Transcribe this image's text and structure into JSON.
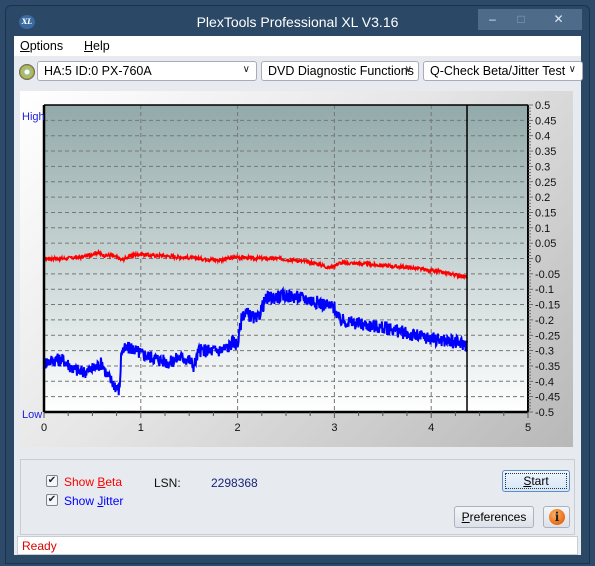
{
  "window": {
    "title": "PlexTools Professional XL V3.16",
    "app_icon_label": "XL",
    "controls": {
      "minimize": "–",
      "maximize": "□",
      "close": "✕"
    }
  },
  "menu": {
    "items": [
      {
        "label": "Options",
        "mnemonic": "O",
        "rest": "ptions"
      },
      {
        "label": "Help",
        "mnemonic": "H",
        "rest": "elp"
      }
    ]
  },
  "toolbar": {
    "drive_select": {
      "value": "HA:5 ID:0  PX-760A"
    },
    "function_select": {
      "value": "DVD Diagnostic Functions"
    },
    "test_select": {
      "value": "Q-Check Beta/Jitter Test"
    }
  },
  "chart": {
    "high_label": "High",
    "low_label": "Low"
  },
  "chart_data": {
    "type": "line",
    "title": "",
    "xlabel": "",
    "ylabel": "",
    "xlim": [
      0,
      5
    ],
    "ylim": [
      -0.5,
      0.5
    ],
    "x_ticks": [
      "0",
      "1",
      "2",
      "3",
      "4",
      "5"
    ],
    "y_ticks": [
      "0.5",
      "0.45",
      "0.4",
      "0.35",
      "0.3",
      "0.25",
      "0.2",
      "0.15",
      "0.1",
      "0.05",
      "0",
      "-0.05",
      "-0.1",
      "-0.15",
      "-0.2",
      "-0.25",
      "-0.3",
      "-0.35",
      "-0.4",
      "-0.45",
      "-0.5"
    ],
    "left_axis_labels": {
      "top": "High",
      "bottom": "Low"
    },
    "grid": true,
    "marker_line_x": 4.37,
    "series": [
      {
        "name": "Beta",
        "color": "#ff0000",
        "x": [
          0,
          0.2,
          0.4,
          0.55,
          0.62,
          0.7,
          0.78,
          0.8,
          0.9,
          1.0,
          1.1,
          1.2,
          1.4,
          1.6,
          1.8,
          2.0,
          2.2,
          2.4,
          2.6,
          2.8,
          2.95,
          3.05,
          3.2,
          3.4,
          3.6,
          3.8,
          4.0,
          4.2,
          4.37
        ],
        "y": [
          0.0,
          0.0,
          0.005,
          0.02,
          0.01,
          0.01,
          0.0,
          -0.005,
          0.01,
          0.015,
          0.01,
          0.01,
          0.005,
          0.0,
          -0.005,
          0.005,
          0.0,
          0.0,
          -0.005,
          -0.015,
          -0.03,
          -0.015,
          -0.015,
          -0.02,
          -0.025,
          -0.03,
          -0.04,
          -0.05,
          -0.06
        ]
      },
      {
        "name": "Jitter",
        "color": "#0000ff",
        "x": [
          0,
          0.1,
          0.2,
          0.3,
          0.4,
          0.5,
          0.6,
          0.65,
          0.7,
          0.75,
          0.78,
          0.8,
          0.9,
          1.0,
          1.1,
          1.2,
          1.3,
          1.4,
          1.5,
          1.55,
          1.6,
          1.7,
          1.8,
          1.9,
          1.95,
          2.0,
          2.05,
          2.1,
          2.2,
          2.25,
          2.3,
          2.5,
          2.7,
          2.9,
          3.0,
          3.05,
          3.2,
          3.4,
          3.6,
          3.8,
          4.0,
          4.2,
          4.37
        ],
        "y": [
          -0.34,
          -0.33,
          -0.33,
          -0.36,
          -0.37,
          -0.36,
          -0.34,
          -0.38,
          -0.4,
          -0.42,
          -0.43,
          -0.3,
          -0.29,
          -0.31,
          -0.32,
          -0.33,
          -0.34,
          -0.32,
          -0.33,
          -0.35,
          -0.3,
          -0.3,
          -0.3,
          -0.29,
          -0.27,
          -0.28,
          -0.18,
          -0.18,
          -0.2,
          -0.16,
          -0.13,
          -0.12,
          -0.13,
          -0.15,
          -0.16,
          -0.2,
          -0.21,
          -0.22,
          -0.23,
          -0.25,
          -0.26,
          -0.27,
          -0.28
        ]
      }
    ]
  },
  "controls": {
    "show_beta": {
      "label": "Show Beta",
      "prefix": "Show ",
      "mnemonic": "B",
      "rest": "eta",
      "checked": true,
      "color": "#ff0000"
    },
    "show_jitter": {
      "label": "Show Jitter",
      "prefix": "Show ",
      "mnemonic": "J",
      "rest": "itter",
      "checked": true,
      "color": "#0000ff"
    },
    "lsn_label": "LSN:",
    "lsn_value": "2298368",
    "start_button": {
      "label": "Start",
      "mnemonic": "S",
      "rest": "tart"
    },
    "preferences_button": {
      "label": "Preferences",
      "mnemonic": "P",
      "rest": "references"
    },
    "info_button": {
      "icon": "i"
    }
  },
  "status": {
    "text": "Ready"
  }
}
